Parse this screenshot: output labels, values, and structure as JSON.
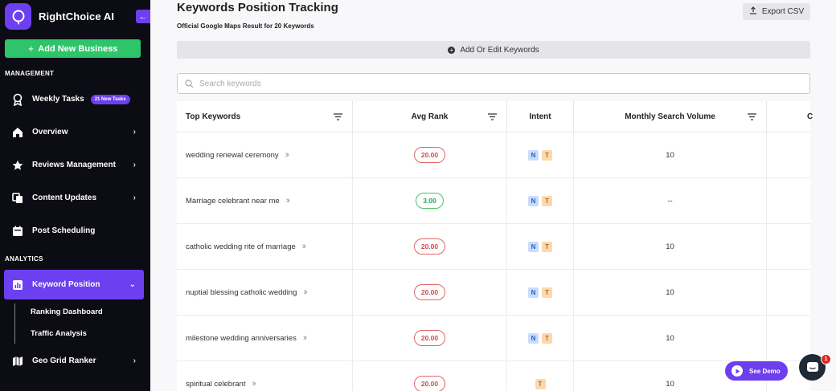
{
  "brand": {
    "name": "RightChoice AI"
  },
  "sidebar": {
    "add_business_label": "Add New Business",
    "section_management": "MANAGEMENT",
    "section_analytics": "ANALYTICS",
    "items": [
      {
        "label": "Weekly Tasks",
        "badge": "21 New Tasks"
      },
      {
        "label": "Overview"
      },
      {
        "label": "Reviews Management"
      },
      {
        "label": "Content Updates"
      },
      {
        "label": "Post Scheduling"
      },
      {
        "label": "Keyword Position"
      },
      {
        "label": "Geo Grid Ranker"
      }
    ],
    "sub_items": [
      {
        "label": "Ranking Dashboard"
      },
      {
        "label": "Traffic Analysis"
      }
    ]
  },
  "main": {
    "title": "Keywords Position Tracking",
    "subtitle": "Official Google Maps Result for 20 Keywords",
    "export_label": "Export CSV",
    "add_edit_label": "Add Or Edit Keywords",
    "search_placeholder": "Search keywords"
  },
  "table": {
    "headers": [
      "Top Keywords",
      "Avg Rank",
      "Intent",
      "Monthly Search Volume",
      "C"
    ],
    "rows": [
      {
        "keyword": "wedding renewal ceremony",
        "rank": "20.00",
        "rank_status": "red",
        "intent": [
          "N",
          "T"
        ],
        "volume": "10"
      },
      {
        "keyword": "Marriage celebrant near me",
        "rank": "3.00",
        "rank_status": "green",
        "intent": [
          "N",
          "T"
        ],
        "volume": "--"
      },
      {
        "keyword": "catholic wedding rite of marriage",
        "rank": "20.00",
        "rank_status": "red",
        "intent": [
          "N",
          "T"
        ],
        "volume": "10"
      },
      {
        "keyword": "nuptial blessing catholic wedding",
        "rank": "20.00",
        "rank_status": "red",
        "intent": [
          "N",
          "T"
        ],
        "volume": "10"
      },
      {
        "keyword": "milestone wedding anniversaries",
        "rank": "20.00",
        "rank_status": "red",
        "intent": [
          "N",
          "T"
        ],
        "volume": "10"
      },
      {
        "keyword": "spiritual celebrant",
        "rank": "20.00",
        "rank_status": "red",
        "intent": [
          "T"
        ],
        "volume": "10"
      }
    ]
  },
  "widgets": {
    "see_demo_label": "See Demo",
    "chat_badge_count": "1"
  },
  "colors": {
    "accent": "#6c3ff0",
    "success": "#2ec46a",
    "sidebar_bg": "#0c0c14"
  }
}
